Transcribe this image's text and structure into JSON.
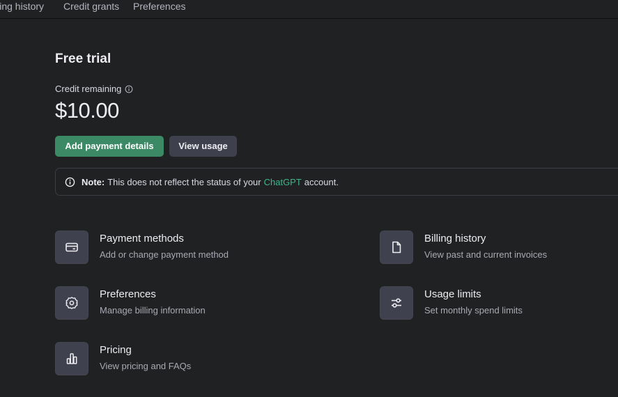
{
  "tabs": [
    "lling history",
    "Credit grants",
    "Preferences"
  ],
  "plan": {
    "title": "Free trial",
    "credit_label": "Credit remaining",
    "credit_amount": "$10.00"
  },
  "buttons": {
    "add_payment": "Add payment details",
    "view_usage": "View usage"
  },
  "note": {
    "label": "Note:",
    "text_before": "This does not reflect the status of your",
    "link": "ChatGPT",
    "text_after": "account."
  },
  "cards": [
    {
      "title": "Payment methods",
      "subtitle": "Add or change payment method",
      "icon": "credit-card-icon"
    },
    {
      "title": "Billing history",
      "subtitle": "View past and current invoices",
      "icon": "document-icon"
    },
    {
      "title": "Preferences",
      "subtitle": "Manage billing information",
      "icon": "gear-icon"
    },
    {
      "title": "Usage limits",
      "subtitle": "Set monthly spend limits",
      "icon": "sliders-icon"
    },
    {
      "title": "Pricing",
      "subtitle": "View pricing and FAQs",
      "icon": "bar-chart-icon"
    }
  ],
  "colors": {
    "background": "#202123",
    "primary_button": "#3b8a65",
    "secondary_button": "#3f404d",
    "link": "#3fb68b"
  }
}
